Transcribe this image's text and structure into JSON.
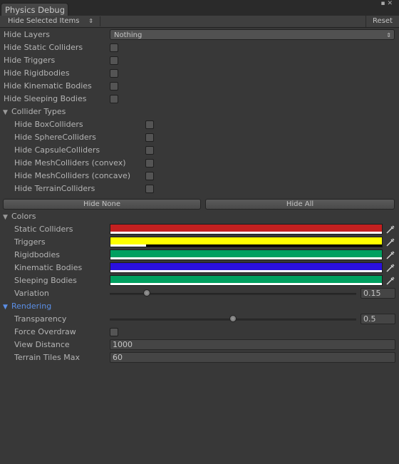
{
  "window": {
    "tab_title": "Physics Debug"
  },
  "toolbar": {
    "mode_label": "Hide Selected Items",
    "reset_label": "Reset"
  },
  "general": {
    "hide_layers": {
      "label": "Hide Layers",
      "value": "Nothing"
    },
    "toggles": [
      {
        "label": "Hide Static Colliders",
        "checked": false
      },
      {
        "label": "Hide Triggers",
        "checked": false
      },
      {
        "label": "Hide Rigidbodies",
        "checked": false
      },
      {
        "label": "Hide Kinematic Bodies",
        "checked": false
      },
      {
        "label": "Hide Sleeping Bodies",
        "checked": false
      }
    ]
  },
  "collider_types": {
    "label": "Collider Types",
    "expanded": true,
    "items": [
      {
        "label": "Hide BoxColliders",
        "checked": false
      },
      {
        "label": "Hide SphereColliders",
        "checked": false
      },
      {
        "label": "Hide CapsuleColliders",
        "checked": false
      },
      {
        "label": "Hide MeshColliders (convex)",
        "checked": false
      },
      {
        "label": "Hide MeshColliders (concave)",
        "checked": false
      },
      {
        "label": "Hide TerrainColliders",
        "checked": false
      }
    ],
    "hide_none_label": "Hide None",
    "hide_all_label": "Hide All"
  },
  "colors": {
    "label": "Colors",
    "expanded": true,
    "items": [
      {
        "label": "Static Colliders",
        "color": "#c42020",
        "alpha": 1.0
      },
      {
        "label": "Triggers",
        "color": "#ffff00",
        "alpha": 0.13
      },
      {
        "label": "Rigidbodies",
        "color": "#00a060",
        "alpha": 1.0
      },
      {
        "label": "Kinematic Bodies",
        "color": "#2a10e0",
        "alpha": 1.0
      },
      {
        "label": "Sleeping Bodies",
        "color": "#00a060",
        "alpha": 1.0
      }
    ],
    "variation": {
      "label": "Variation",
      "value": "0.15",
      "fraction": 0.15
    }
  },
  "rendering": {
    "label": "Rendering",
    "expanded": true,
    "accent_color": "#5b8fe6",
    "transparency": {
      "label": "Transparency",
      "value": "0.5",
      "fraction": 0.5
    },
    "force_overdraw": {
      "label": "Force Overdraw",
      "checked": false
    },
    "view_distance": {
      "label": "View Distance",
      "value": "1000"
    },
    "terrain_tiles_max": {
      "label": "Terrain Tiles Max",
      "value": "60"
    }
  }
}
